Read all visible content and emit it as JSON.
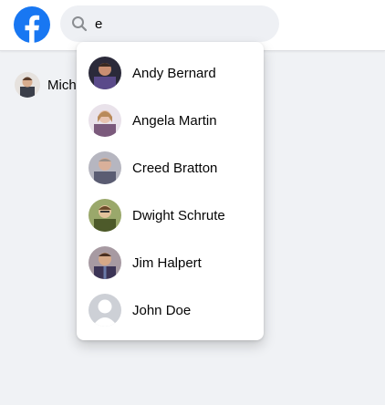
{
  "header": {
    "logo_icon": "facebook-logo-icon",
    "brand_color": "#1877f2",
    "search": {
      "icon": "search-icon",
      "value": "e",
      "placeholder": ""
    }
  },
  "left_panel": {
    "profile_name": "Mich"
  },
  "search_results": [
    {
      "name": "Andy Bernard",
      "avatar_colors": [
        "#2b2a3a",
        "#5a4a8a",
        "#c98f72"
      ]
    },
    {
      "name": "Angela Martin",
      "avatar_colors": [
        "#e9e2ea",
        "#7b5a7c",
        "#e8c3b0"
      ]
    },
    {
      "name": "Creed Bratton",
      "avatar_colors": [
        "#b6b6c0",
        "#5a5c72",
        "#d9b09a"
      ]
    },
    {
      "name": "Dwight Schrute",
      "avatar_colors": [
        "#9aa86b",
        "#4d5a2a",
        "#e3c29b"
      ]
    },
    {
      "name": "Jim Halpert",
      "avatar_colors": [
        "#a79aa2",
        "#3c3456",
        "#d6a987"
      ]
    },
    {
      "name": "John Doe",
      "avatar_colors": [
        "#cdd0d6",
        "#ffffff",
        "#ffffff"
      ]
    }
  ]
}
